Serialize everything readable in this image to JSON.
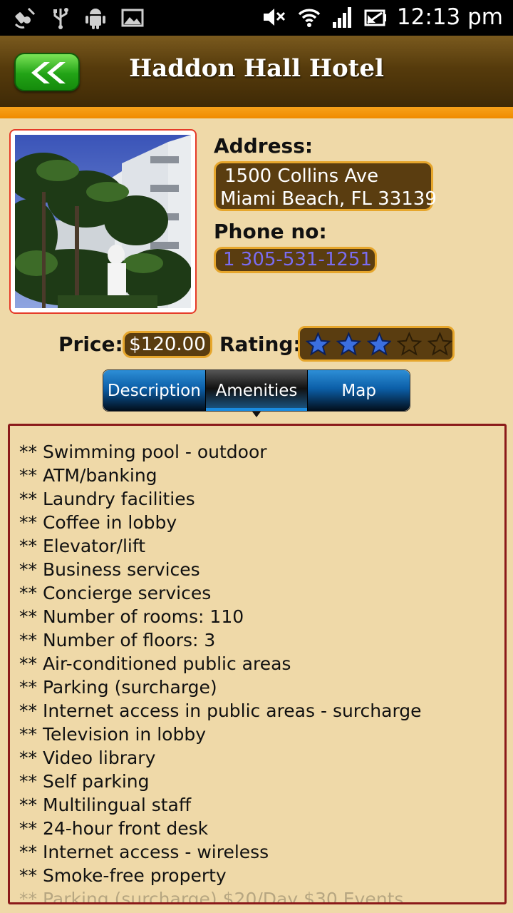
{
  "status_bar": {
    "time": "12:13 pm",
    "left_icons": [
      "satellite-icon",
      "usb-icon",
      "android-icon",
      "image-icon"
    ],
    "right_icons": [
      "mute-icon",
      "wifi-icon",
      "signal-icon",
      "battery-icon"
    ]
  },
  "header": {
    "title": "Haddon Hall Hotel",
    "back_icon": "double-chevron-left-icon",
    "colors": {
      "bar": "#563b0c",
      "strip": "#f08b00",
      "back_button": "#22a316"
    }
  },
  "hotel": {
    "address_label": "Address:",
    "address_line1": "1500 Collins Ave",
    "address_line2": "Miami Beach, FL 33139",
    "phone_label": "Phone no:",
    "phone": "1 305-531-1251",
    "price_label": "Price:",
    "price": "$120.00",
    "rating_label": "Rating:",
    "rating": 3,
    "rating_max": 5
  },
  "tabs": [
    {
      "label": "Description",
      "active": false
    },
    {
      "label": "Amenities",
      "active": true
    },
    {
      "label": "Map",
      "active": false
    }
  ],
  "amenities": [
    "** Swimming pool - outdoor",
    "** ATM/banking",
    "** Laundry facilities",
    "** Coffee in lobby",
    "** Elevator/lift",
    "** Business services",
    "** Concierge services",
    "** Number of rooms: 110",
    "** Number of floors: 3",
    "** Air-conditioned public areas",
    "** Parking (surcharge)",
    "** Internet access in public areas - surcharge",
    "** Television in lobby",
    "** Video library",
    "** Self parking",
    "** Multilingual staff",
    "** 24-hour front desk",
    "** Internet access - wireless",
    "** Smoke-free property",
    "** Parking (surcharge) $20/Day $30 Events"
  ]
}
